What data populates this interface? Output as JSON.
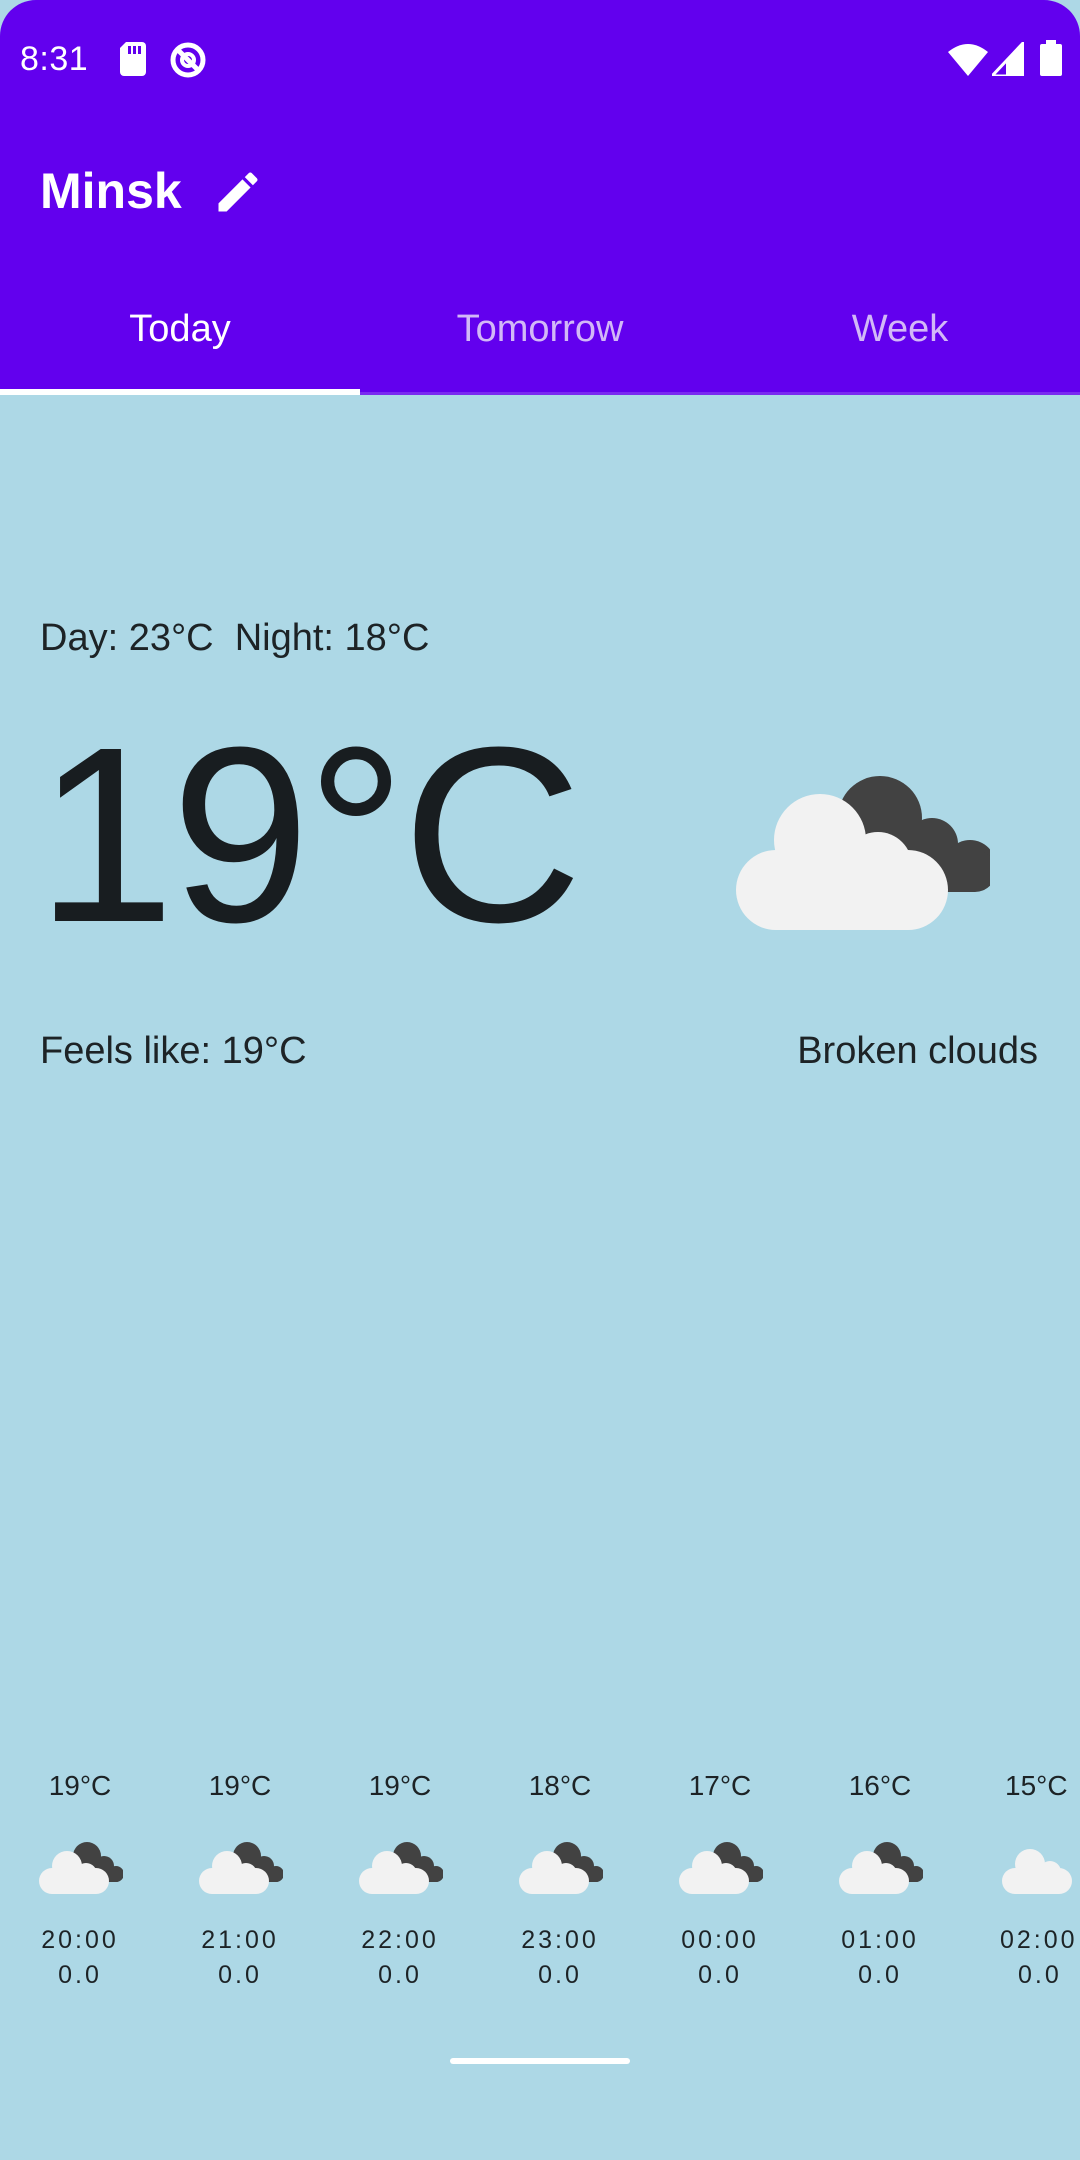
{
  "status_bar": {
    "time": "8:31",
    "icons": [
      "sd-card-icon",
      "sync-icon",
      "wifi-icon",
      "signal-icon",
      "battery-icon"
    ]
  },
  "header": {
    "city": "Minsk",
    "edit_icon": "pencil-icon"
  },
  "tabs": [
    {
      "label": "Today",
      "active": true
    },
    {
      "label": "Tomorrow",
      "active": false
    },
    {
      "label": "Week",
      "active": false
    }
  ],
  "current": {
    "day_night": "Day: 23°C  Night: 18°C",
    "temperature": "19°C",
    "feels_like": "Feels like: 19°C",
    "condition": "Broken clouds",
    "icon": "broken-clouds-icon"
  },
  "hourly": [
    {
      "temp": "19°C",
      "time": "20:00",
      "precip": "0.0",
      "icon": "broken-clouds-icon"
    },
    {
      "temp": "19°C",
      "time": "21:00",
      "precip": "0.0",
      "icon": "broken-clouds-icon"
    },
    {
      "temp": "19°C",
      "time": "22:00",
      "precip": "0.0",
      "icon": "broken-clouds-icon"
    },
    {
      "temp": "18°C",
      "time": "23:00",
      "precip": "0.0",
      "icon": "broken-clouds-icon"
    },
    {
      "temp": "17°C",
      "time": "00:00",
      "precip": "0.0",
      "icon": "broken-clouds-icon"
    },
    {
      "temp": "16°C",
      "time": "01:00",
      "precip": "0.0",
      "icon": "broken-clouds-icon"
    },
    {
      "temp": "15°C",
      "time": "02:00",
      "precip": "0.0",
      "icon": "cloud-icon"
    }
  ],
  "colors": {
    "primary": "#6200EE",
    "background": "#ADD8E6",
    "tab_inactive": "#D2B8F7",
    "text": "#1d2326"
  }
}
